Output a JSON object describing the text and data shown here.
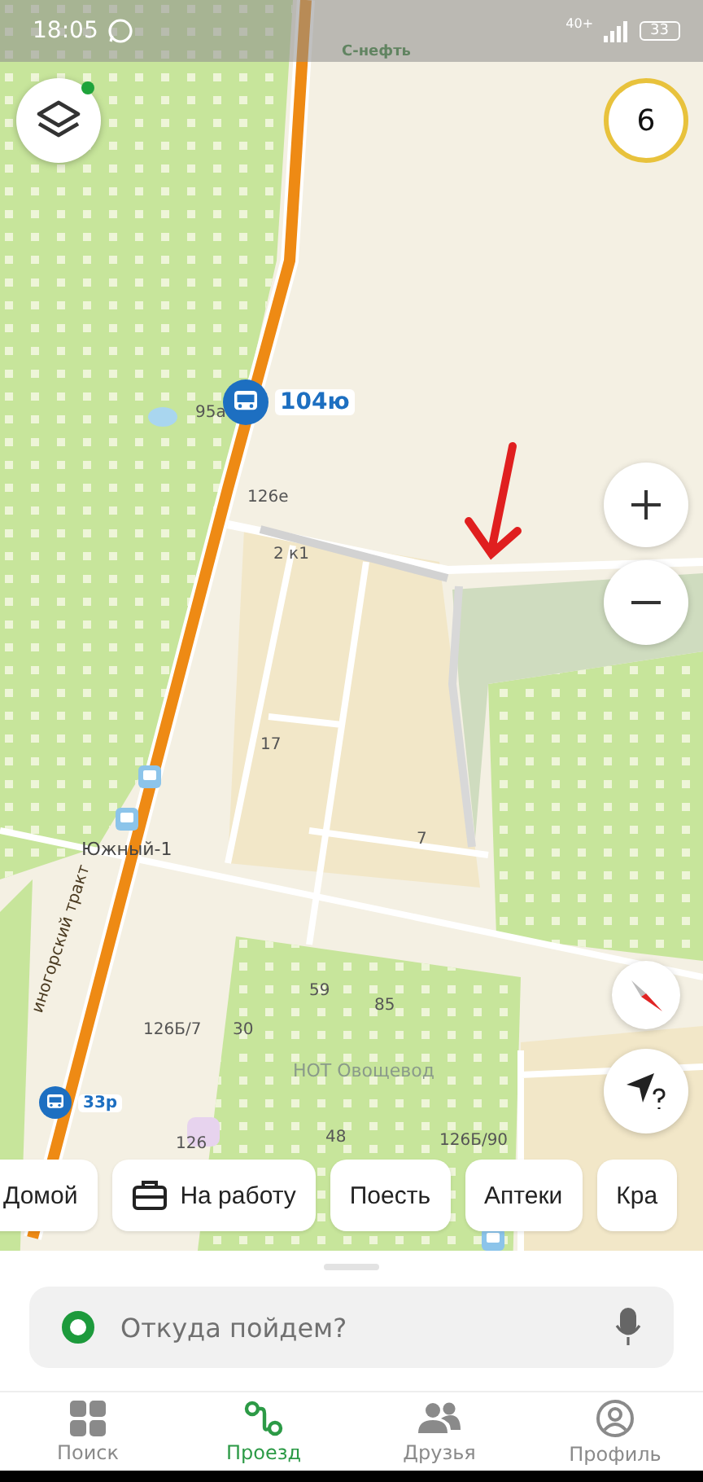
{
  "status_bar": {
    "time": "18:05",
    "network": "40+",
    "battery": "33"
  },
  "map": {
    "labels": [
      {
        "text": "С-нефть",
        "kind": "poi"
      },
      {
        "text": "95а",
        "kind": "house"
      },
      {
        "text": "126е",
        "kind": "house"
      },
      {
        "text": "2 к1",
        "kind": "house"
      },
      {
        "text": "17",
        "kind": "house"
      },
      {
        "text": "7",
        "kind": "house"
      },
      {
        "text": "Южный-1",
        "kind": "stop"
      },
      {
        "text": "59",
        "kind": "house"
      },
      {
        "text": "85",
        "kind": "house"
      },
      {
        "text": "126Б/7",
        "kind": "house"
      },
      {
        "text": "30",
        "kind": "house"
      },
      {
        "text": "НОТ Овощевод",
        "kind": "area"
      },
      {
        "text": "48",
        "kind": "house"
      },
      {
        "text": "126",
        "kind": "house"
      },
      {
        "text": "126Б/90",
        "kind": "house"
      },
      {
        "text": "иногорский тракт",
        "kind": "road"
      }
    ],
    "routes": [
      {
        "label": "104ю",
        "kind": "pinned"
      },
      {
        "label": "33р",
        "kind": "regular"
      }
    ],
    "layers_button": {
      "badge": true
    },
    "counter": "6"
  },
  "chips": [
    {
      "label": "Домой",
      "icon": false
    },
    {
      "label": "На работу",
      "icon": true
    },
    {
      "label": "Поесть",
      "icon": false
    },
    {
      "label": "Аптеки",
      "icon": false
    },
    {
      "label": "Кра",
      "icon": false
    }
  ],
  "search": {
    "placeholder": "Откуда пойдем?"
  },
  "tabs": [
    {
      "label": "Поиск",
      "selected": false
    },
    {
      "label": "Проезд",
      "selected": true
    },
    {
      "label": "Друзья",
      "selected": false
    },
    {
      "label": "Профиль",
      "selected": false
    }
  ]
}
